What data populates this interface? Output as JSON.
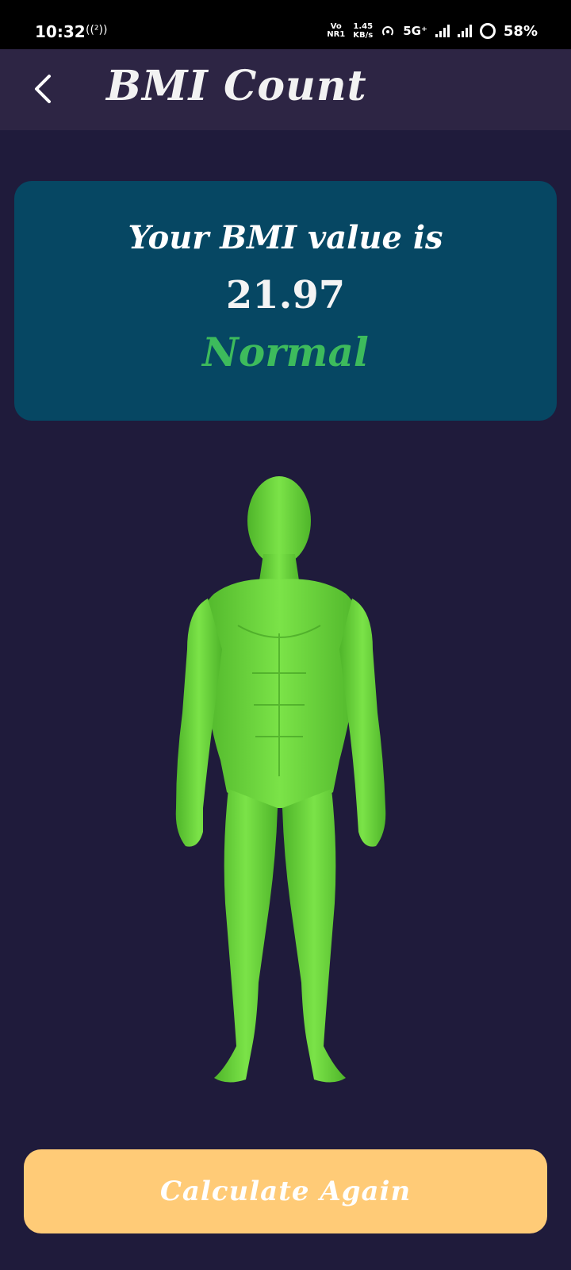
{
  "status_bar": {
    "time": "10:32",
    "nfc_indicator": "((²))",
    "volte_top": "Vo",
    "volte_bottom": "NR1",
    "speed_value": "1.45",
    "speed_unit": "KB/s",
    "network": "5G⁺",
    "battery": "58%"
  },
  "app_bar": {
    "back_icon": "chevron-left-icon",
    "title": "BMI Count"
  },
  "result": {
    "heading": "Your BMI value is",
    "value": "21.97",
    "category": "Normal"
  },
  "figure": {
    "icon": "body-figure-icon"
  },
  "actions": {
    "calculate_again_label": "Calculate Again"
  },
  "colors": {
    "background": "#1f1b3b",
    "app_bar": "#2d2544",
    "card": "#064763",
    "normal_status": "#3dbb5c",
    "button": "#ffcb77",
    "figure": "#6fd93a"
  }
}
